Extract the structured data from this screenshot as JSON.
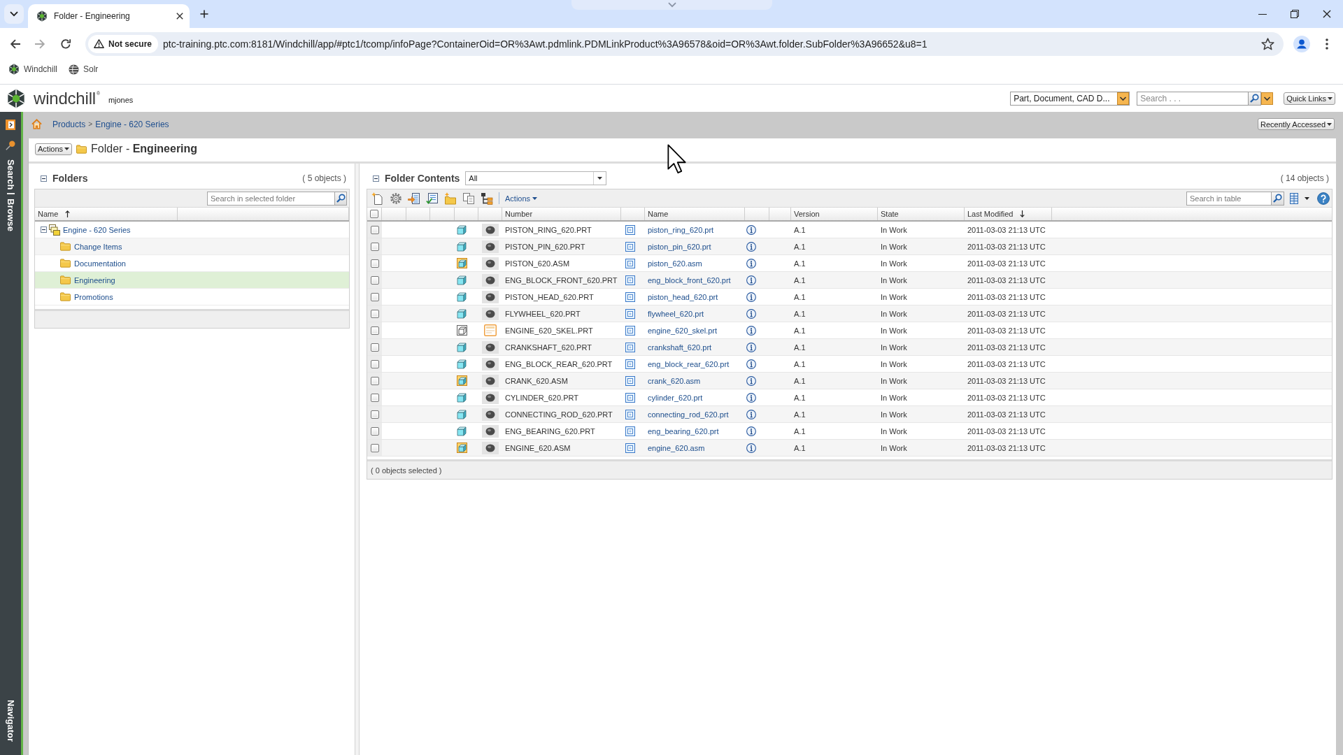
{
  "browser": {
    "tabs": [
      {
        "title": "Folder - Engineering",
        "selected": true
      }
    ],
    "security": "Not secure",
    "url": "ptc-training.ptc.com:8181/Windchill/app/#ptc1/tcomp/infoPage?ContainerOid=OR%3Awt.pdmlink.PDMLinkProduct%3A96578&oid=OR%3Awt.folder.SubFolder%3A96652&u8=1",
    "bookmarks": [
      {
        "label": "Windchill",
        "kind": "app"
      },
      {
        "label": "Solr",
        "kind": "web"
      }
    ]
  },
  "header": {
    "app_name": "windchill$^{®}$",
    "user": "mjones",
    "search_type": "Part, Document, CAD D...",
    "search": {
      "placeholder": "Search . . ."
    },
    "quick_links": "Quick Links"
  },
  "sidebar": {
    "tabs": [
      "Search",
      "Browse"
    ],
    "bottom_tab": "Navigator"
  },
  "breadcrumb": {
    "items": [
      "Products",
      "Engine - 620 Series"
    ],
    "separator": ">"
  },
  "recently_accessed": "Recently Accessed",
  "page": {
    "actions": "Actions",
    "title": "Folder - **Engineering**"
  },
  "folders": {
    "title": "Folders",
    "expanded": true,
    "count": "( 5 objects )",
    "search": {
      "placeholder": "Search in selected folder"
    },
    "column": {
      "label": "Name",
      "sorted": true,
      "descending": false
    },
    "tree": [
      {
        "name": "Engine - 620 Series",
        "kind": "product",
        "expanded": true,
        "selected": false,
        "children": [
          {
            "name": "Change Items",
            "kind": "folder",
            "selected": false
          },
          {
            "name": "Documentation",
            "kind": "folder",
            "selected": false
          },
          {
            "name": "Engineering",
            "kind": "folder",
            "selected": true
          },
          {
            "name": "Promotions",
            "kind": "folder",
            "selected": false
          }
        ]
      }
    ]
  },
  "contents": {
    "title": "Folder Contents",
    "expanded": true,
    "view": "All",
    "count": "( 14 objects )",
    "actions": "Actions",
    "search": {
      "placeholder": "Search in table"
    },
    "select_all": false,
    "columns": [
      {
        "label": "Number"
      },
      {
        "label": "Name"
      },
      {
        "label": "Version"
      },
      {
        "label": "State"
      },
      {
        "label": "Last Modified",
        "sorted": true,
        "descending": true
      }
    ],
    "rows": [
      {
        "checked": false,
        "kind": "part",
        "number": "PISTON_RING_620.PRT",
        "name": "piston_ring_620.prt",
        "version": "A.1",
        "state": "In Work",
        "modified": "2011-03-03 21:13 UTC"
      },
      {
        "checked": false,
        "kind": "part",
        "number": "PISTON_PIN_620.PRT",
        "name": "piston_pin_620.prt",
        "version": "A.1",
        "state": "In Work",
        "modified": "2011-03-03 21:13 UTC"
      },
      {
        "checked": false,
        "kind": "assembly",
        "number": "PISTON_620.ASM",
        "name": "piston_620.asm",
        "version": "A.1",
        "state": "In Work",
        "modified": "2011-03-03 21:13 UTC"
      },
      {
        "checked": false,
        "kind": "part",
        "number": "ENG_BLOCK_FRONT_620.PRT",
        "name": "eng_block_front_620.prt",
        "version": "A.1",
        "state": "In Work",
        "modified": "2011-03-03 21:13 UTC"
      },
      {
        "checked": false,
        "kind": "part",
        "number": "PISTON_HEAD_620.PRT",
        "name": "piston_head_620.prt",
        "version": "A.1",
        "state": "In Work",
        "modified": "2011-03-03 21:13 UTC"
      },
      {
        "checked": false,
        "kind": "part",
        "number": "FLYWHEEL_620.PRT",
        "name": "flywheel_620.prt",
        "version": "A.1",
        "state": "In Work",
        "modified": "2011-03-03 21:13 UTC"
      },
      {
        "checked": false,
        "kind": "skeleton",
        "number": "ENGINE_620_SKEL.PRT",
        "name": "engine_620_skel.prt",
        "version": "A.1",
        "state": "In Work",
        "modified": "2011-03-03 21:13 UTC"
      },
      {
        "checked": false,
        "kind": "part",
        "number": "CRANKSHAFT_620.PRT",
        "name": "crankshaft_620.prt",
        "version": "A.1",
        "state": "In Work",
        "modified": "2011-03-03 21:13 UTC"
      },
      {
        "checked": false,
        "kind": "part",
        "number": "ENG_BLOCK_REAR_620.PRT",
        "name": "eng_block_rear_620.prt",
        "version": "A.1",
        "state": "In Work",
        "modified": "2011-03-03 21:13 UTC"
      },
      {
        "checked": false,
        "kind": "assembly",
        "number": "CRANK_620.ASM",
        "name": "crank_620.asm",
        "version": "A.1",
        "state": "In Work",
        "modified": "2011-03-03 21:13 UTC"
      },
      {
        "checked": false,
        "kind": "part",
        "number": "CYLINDER_620.PRT",
        "name": "cylinder_620.prt",
        "version": "A.1",
        "state": "In Work",
        "modified": "2011-03-03 21:13 UTC"
      },
      {
        "checked": false,
        "kind": "part",
        "number": "CONNECTING_ROD_620.PRT",
        "name": "connecting_rod_620.prt",
        "version": "A.1",
        "state": "In Work",
        "modified": "2011-03-03 21:13 UTC"
      },
      {
        "checked": false,
        "kind": "part",
        "number": "ENG_BEARING_620.PRT",
        "name": "eng_bearing_620.prt",
        "version": "A.1",
        "state": "In Work",
        "modified": "2011-03-03 21:13 UTC"
      },
      {
        "checked": false,
        "kind": "assembly",
        "number": "ENGINE_620.ASM",
        "name": "engine_620.asm",
        "version": "A.1",
        "state": "In Work",
        "modified": "2011-03-03 21:13 UTC"
      }
    ],
    "selection": "( 0 objects selected )"
  }
}
